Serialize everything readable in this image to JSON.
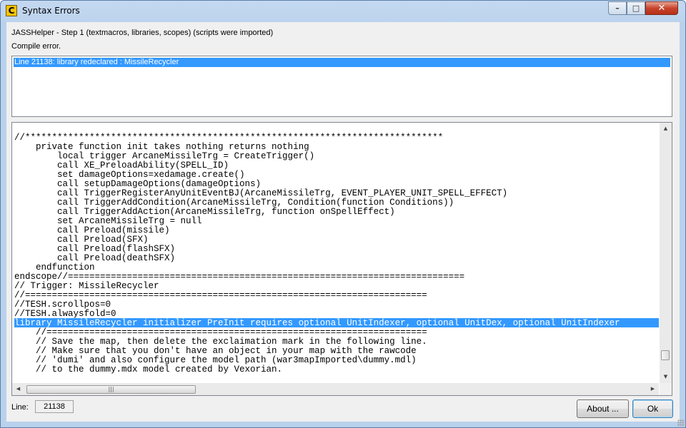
{
  "window": {
    "title": "Syntax Errors",
    "icon_letter": "C",
    "controls": {
      "minimize": "–",
      "maximize": "□",
      "close": "✕"
    }
  },
  "status": {
    "step": "JASSHelper - Step 1 (textmacros, libraries, scopes) (scripts were imported)",
    "message": "Compile error."
  },
  "errors": [
    {
      "text": "Line 21138: library redeclared : MissileRecycler",
      "selected": true
    }
  ],
  "code": {
    "highlighted_line": 20,
    "lines": [
      "//******************************************************************************",
      "    private function init takes nothing returns nothing",
      "        local trigger ArcaneMissileTrg = CreateTrigger()",
      "        call XE_PreloadAbility(SPELL_ID)",
      "        set damageOptions=xedamage.create()",
      "        call setupDamageOptions(damageOptions)",
      "        call TriggerRegisterAnyUnitEventBJ(ArcaneMissileTrg, EVENT_PLAYER_UNIT_SPELL_EFFECT)",
      "        call TriggerAddCondition(ArcaneMissileTrg, Condition(function Conditions))",
      "        call TriggerAddAction(ArcaneMissileTrg, function onSpellEffect)",
      "        set ArcaneMissileTrg = null",
      "        call Preload(missile)",
      "        call Preload(SFX)",
      "        call Preload(flashSFX)",
      "        call Preload(deathSFX)",
      "    endfunction",
      "endscope//==========================================================================",
      "// Trigger: MissileRecycler",
      "//===========================================================================",
      "//TESH.scrollpos=0",
      "//TESH.alwaysfold=0",
      "library MissileRecycler initializer PreInit requires optional UnitIndexer, optional UnitDex, optional UnitIndexer",
      "    //=======================================================================",
      "    // Save the map, then delete the exclaimation mark in the following line.",
      "    // Make sure that you don't have an object in your map with the rawcode",
      "    // 'dumi' and also configure the model path (war3mapImported\\dummy.mdl)",
      "    // to the dummy.mdx model created by Vexorian."
    ]
  },
  "scroll": {
    "up": "▲",
    "down": "▼",
    "left": "◀",
    "right": "▶",
    "grip": "|||"
  },
  "footer": {
    "line_label": "Line:",
    "line_value": "21138",
    "about_label": "About ...",
    "ok_label": "Ok"
  }
}
